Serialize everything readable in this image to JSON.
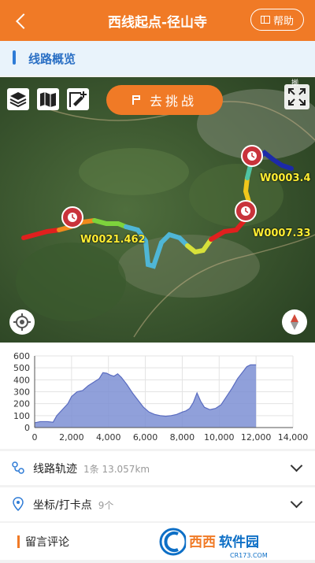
{
  "header": {
    "title": "西线起点-径山寺",
    "help_label": "帮助",
    "color": "#f07a26"
  },
  "overview": {
    "label": "线路概览"
  },
  "map": {
    "challenge_label": "去挑战",
    "waypoints": [
      "W0003.4",
      "W0007.33",
      "W0021.462"
    ],
    "corner_mark": "揃"
  },
  "chart_data": {
    "type": "area",
    "x": [
      0,
      300,
      700,
      1000,
      1200,
      1500,
      1800,
      2000,
      2300,
      2600,
      2900,
      3200,
      3500,
      3700,
      3900,
      4100,
      4300,
      4500,
      4700,
      5000,
      5300,
      5600,
      5900,
      6200,
      6500,
      6800,
      7100,
      7400,
      7700,
      8000,
      8200,
      8400,
      8600,
      8800,
      9000,
      9200,
      9500,
      9800,
      10100,
      10400,
      10700,
      11000,
      11300,
      11500,
      11700,
      12000
    ],
    "y": [
      40,
      50,
      50,
      45,
      100,
      150,
      200,
      260,
      300,
      310,
      350,
      380,
      410,
      460,
      455,
      440,
      430,
      450,
      420,
      360,
      290,
      230,
      170,
      130,
      110,
      100,
      95,
      100,
      110,
      130,
      140,
      160,
      210,
      290,
      220,
      170,
      150,
      160,
      190,
      260,
      330,
      410,
      470,
      510,
      525,
      525
    ],
    "xlim": [
      0,
      14000
    ],
    "ylim": [
      0,
      600
    ],
    "xticks": [
      "0",
      "2,000",
      "4,000",
      "6,000",
      "8,000",
      "10,000",
      "12,000",
      "14,000"
    ],
    "yticks": [
      "0",
      "100",
      "200",
      "300",
      "400",
      "500",
      "600"
    ],
    "fill_color": "#7d8fd4",
    "grid": true
  },
  "rows": {
    "track_label": "线路轨迹",
    "track_sub": "1条 13.057km",
    "checkpoint_label": "坐标/打卡点",
    "checkpoint_sub": "9个",
    "comment_label": "留言评论"
  },
  "watermark": {
    "text": "西西软件园",
    "sub": "CR173.COM"
  }
}
